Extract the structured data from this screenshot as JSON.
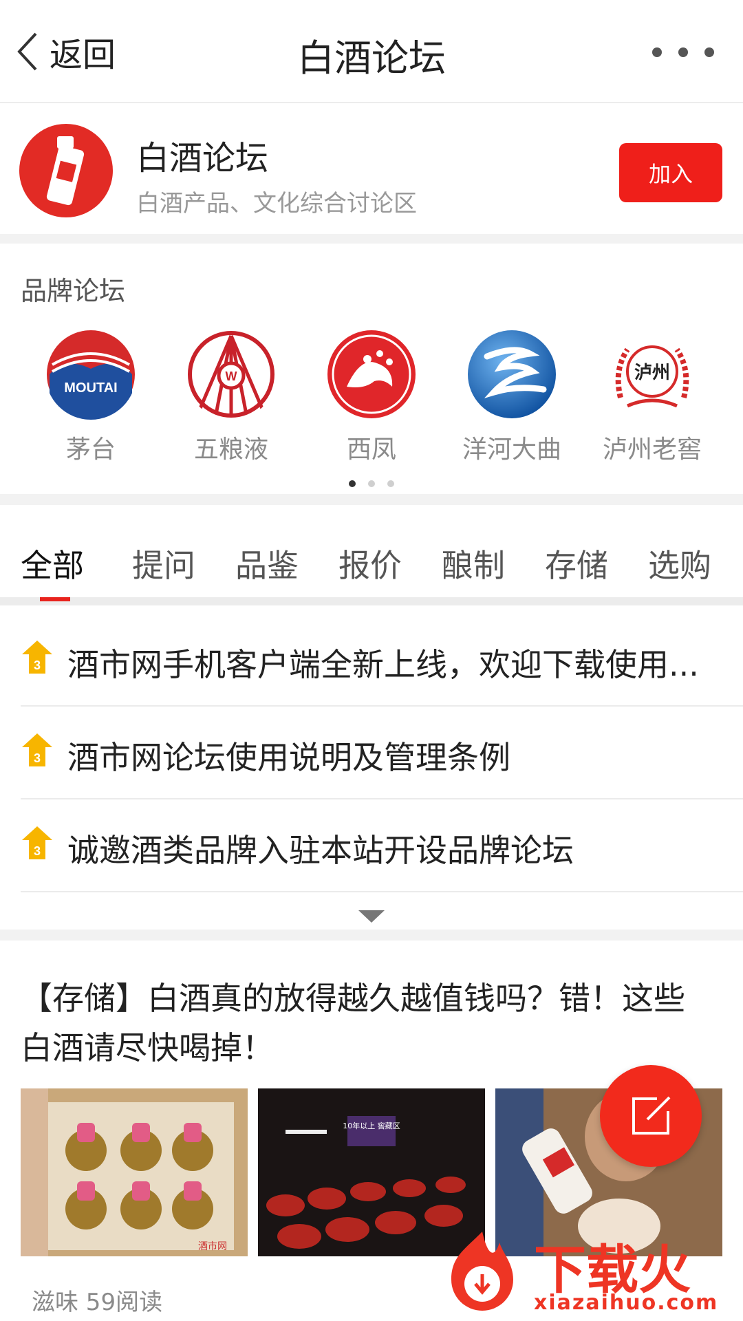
{
  "header": {
    "back_label": "返回",
    "title": "白酒论坛"
  },
  "forum": {
    "name": "白酒论坛",
    "description": "白酒产品、文化综合讨论区",
    "join_label": "加入"
  },
  "brands": {
    "title": "品牌论坛",
    "items": [
      {
        "name": "茅台",
        "logo_text": "MOUTAI"
      },
      {
        "name": "五粮液",
        "logo_text": "W"
      },
      {
        "name": "西凤"
      },
      {
        "name": "洋河大曲"
      },
      {
        "name": "泸州老窖",
        "logo_text": "泸州"
      }
    ],
    "page_count": 3,
    "active_page": 1
  },
  "tabs": [
    "全部",
    "提问",
    "品鉴",
    "报价",
    "酿制",
    "存储",
    "选购"
  ],
  "active_tab": "全部",
  "pinned": [
    {
      "badge": "3",
      "text": "酒市网手机客户端全新上线，欢迎下载使用..."
    },
    {
      "badge": "3",
      "text": "酒市网论坛使用说明及管理条例"
    },
    {
      "badge": "3",
      "text": "诚邀酒类品牌入驻本站开设品牌论坛"
    }
  ],
  "post": {
    "title": "【存储】白酒真的放得越久越值钱吗？错！这些白酒请尽快喝掉！",
    "meta": "滋味 59阅读",
    "thumb_labels": [
      "酒市网",
      "10年以上\n窖藏区"
    ]
  },
  "watermark": {
    "text": "下载火",
    "url": "xiazaihuo.com"
  },
  "colors": {
    "accent": "#ef1f1a",
    "pin_badge": "#f7b500",
    "muted": "#999999"
  }
}
